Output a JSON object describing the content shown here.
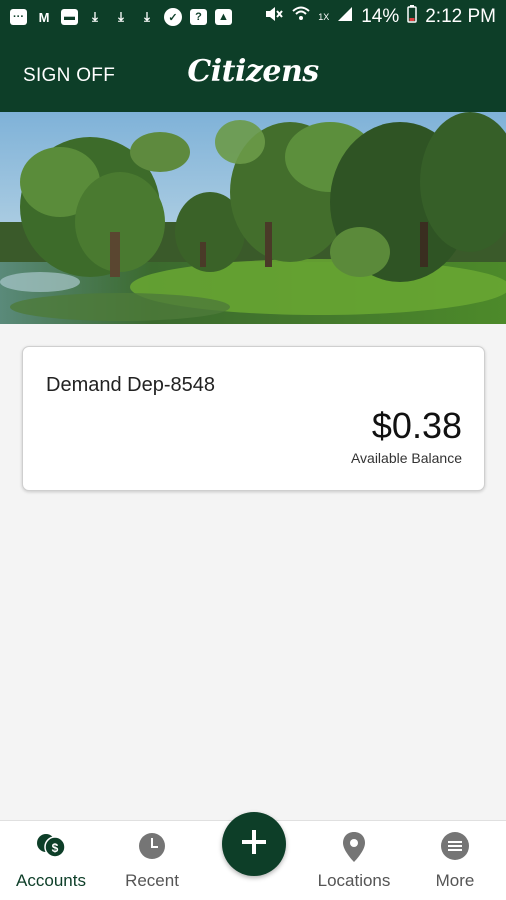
{
  "status_bar": {
    "battery": "14%",
    "time": "2:12 PM",
    "network_label": "1X",
    "notification_icons": [
      "message-icon",
      "gmail-icon",
      "save-icon",
      "download-icon",
      "download-icon",
      "download-icon",
      "check-icon",
      "help-icon",
      "image-icon"
    ]
  },
  "header": {
    "sign_off_label": "SIGN OFF",
    "logo_text": "Citizens"
  },
  "account": {
    "name": "Demand Dep-8548",
    "balance": "$0.38",
    "balance_label": "Available Balance"
  },
  "bottom_nav": {
    "items": [
      {
        "label": "Accounts",
        "icon": "accounts-icon"
      },
      {
        "label": "Recent",
        "icon": "clock-icon"
      },
      {
        "label": "Locations",
        "icon": "location-pin-icon"
      },
      {
        "label": "More",
        "icon": "menu-icon"
      }
    ],
    "active_index": 0,
    "fab_icon": "plus-icon"
  },
  "colors": {
    "brand": "#0d3e28",
    "background": "#f4f4f4",
    "nav_inactive": "#757575"
  }
}
